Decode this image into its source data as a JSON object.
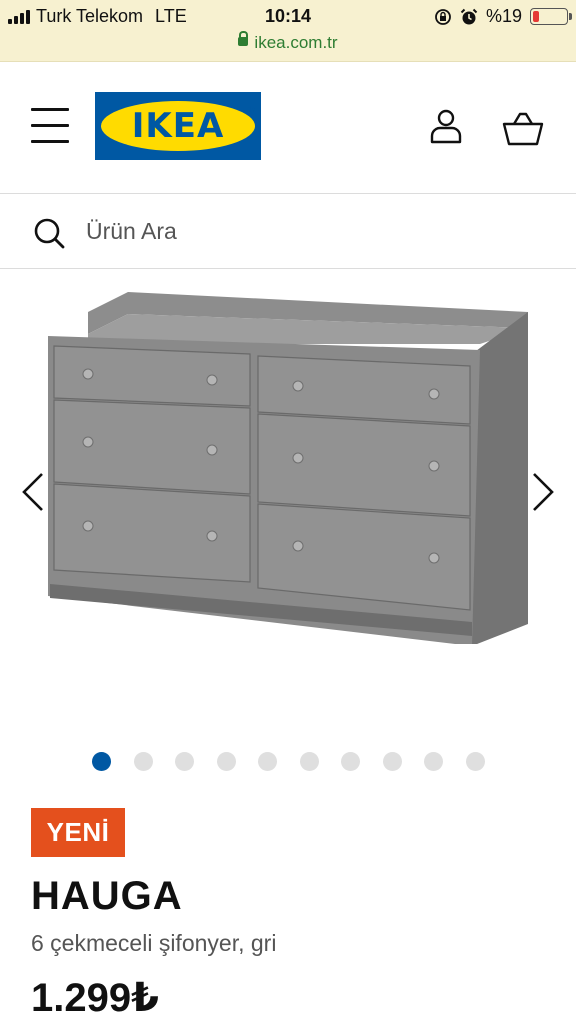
{
  "status_bar": {
    "carrier": "Turk Telekom",
    "network": "LTE",
    "time": "10:14",
    "battery": "%19",
    "battery_level": 0.19,
    "url": "ikea.com.tr"
  },
  "header": {
    "logo_text": "IKEA",
    "menu_icon": "hamburger-menu-icon",
    "profile_icon": "user-icon",
    "cart_icon": "basket-icon"
  },
  "search": {
    "placeholder": "Ürün Ara",
    "icon": "search-icon"
  },
  "gallery": {
    "image_count": 10,
    "active_index": 0,
    "prev_icon": "chevron-left-icon",
    "next_icon": "chevron-right-icon"
  },
  "product": {
    "badge": "YENİ",
    "name": "HAUGA",
    "description": "6 çekmeceli şifonyer, gri",
    "price": "1.299₺"
  },
  "colors": {
    "brand_blue": "#0058a3",
    "brand_yellow": "#ffdb00",
    "badge_orange": "#e4501d",
    "url_green": "#2e7d32"
  }
}
